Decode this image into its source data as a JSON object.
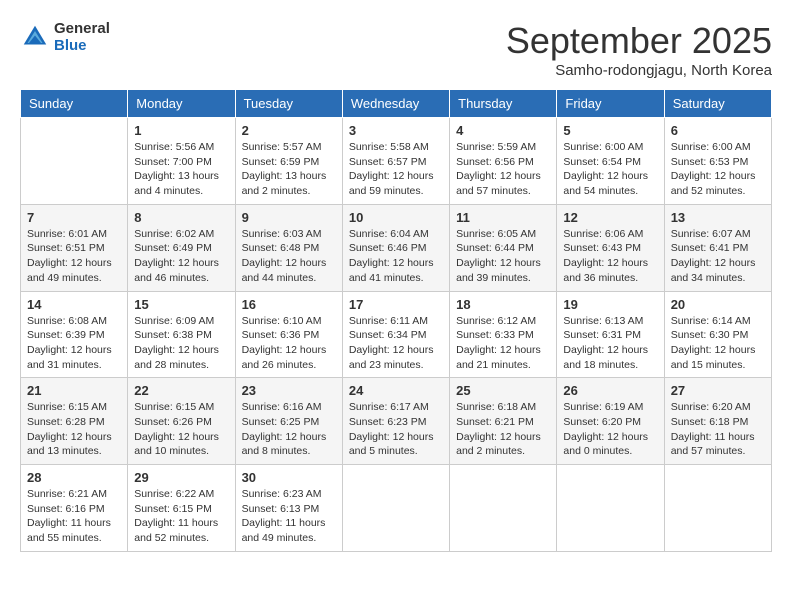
{
  "header": {
    "logo_general": "General",
    "logo_blue": "Blue",
    "month": "September 2025",
    "location": "Samho-rodongjagu, North Korea"
  },
  "days_of_week": [
    "Sunday",
    "Monday",
    "Tuesday",
    "Wednesday",
    "Thursday",
    "Friday",
    "Saturday"
  ],
  "weeks": [
    [
      {
        "day": "",
        "info": ""
      },
      {
        "day": "1",
        "info": "Sunrise: 5:56 AM\nSunset: 7:00 PM\nDaylight: 13 hours\nand 4 minutes."
      },
      {
        "day": "2",
        "info": "Sunrise: 5:57 AM\nSunset: 6:59 PM\nDaylight: 13 hours\nand 2 minutes."
      },
      {
        "day": "3",
        "info": "Sunrise: 5:58 AM\nSunset: 6:57 PM\nDaylight: 12 hours\nand 59 minutes."
      },
      {
        "day": "4",
        "info": "Sunrise: 5:59 AM\nSunset: 6:56 PM\nDaylight: 12 hours\nand 57 minutes."
      },
      {
        "day": "5",
        "info": "Sunrise: 6:00 AM\nSunset: 6:54 PM\nDaylight: 12 hours\nand 54 minutes."
      },
      {
        "day": "6",
        "info": "Sunrise: 6:00 AM\nSunset: 6:53 PM\nDaylight: 12 hours\nand 52 minutes."
      }
    ],
    [
      {
        "day": "7",
        "info": "Sunrise: 6:01 AM\nSunset: 6:51 PM\nDaylight: 12 hours\nand 49 minutes."
      },
      {
        "day": "8",
        "info": "Sunrise: 6:02 AM\nSunset: 6:49 PM\nDaylight: 12 hours\nand 46 minutes."
      },
      {
        "day": "9",
        "info": "Sunrise: 6:03 AM\nSunset: 6:48 PM\nDaylight: 12 hours\nand 44 minutes."
      },
      {
        "day": "10",
        "info": "Sunrise: 6:04 AM\nSunset: 6:46 PM\nDaylight: 12 hours\nand 41 minutes."
      },
      {
        "day": "11",
        "info": "Sunrise: 6:05 AM\nSunset: 6:44 PM\nDaylight: 12 hours\nand 39 minutes."
      },
      {
        "day": "12",
        "info": "Sunrise: 6:06 AM\nSunset: 6:43 PM\nDaylight: 12 hours\nand 36 minutes."
      },
      {
        "day": "13",
        "info": "Sunrise: 6:07 AM\nSunset: 6:41 PM\nDaylight: 12 hours\nand 34 minutes."
      }
    ],
    [
      {
        "day": "14",
        "info": "Sunrise: 6:08 AM\nSunset: 6:39 PM\nDaylight: 12 hours\nand 31 minutes."
      },
      {
        "day": "15",
        "info": "Sunrise: 6:09 AM\nSunset: 6:38 PM\nDaylight: 12 hours\nand 28 minutes."
      },
      {
        "day": "16",
        "info": "Sunrise: 6:10 AM\nSunset: 6:36 PM\nDaylight: 12 hours\nand 26 minutes."
      },
      {
        "day": "17",
        "info": "Sunrise: 6:11 AM\nSunset: 6:34 PM\nDaylight: 12 hours\nand 23 minutes."
      },
      {
        "day": "18",
        "info": "Sunrise: 6:12 AM\nSunset: 6:33 PM\nDaylight: 12 hours\nand 21 minutes."
      },
      {
        "day": "19",
        "info": "Sunrise: 6:13 AM\nSunset: 6:31 PM\nDaylight: 12 hours\nand 18 minutes."
      },
      {
        "day": "20",
        "info": "Sunrise: 6:14 AM\nSunset: 6:30 PM\nDaylight: 12 hours\nand 15 minutes."
      }
    ],
    [
      {
        "day": "21",
        "info": "Sunrise: 6:15 AM\nSunset: 6:28 PM\nDaylight: 12 hours\nand 13 minutes."
      },
      {
        "day": "22",
        "info": "Sunrise: 6:15 AM\nSunset: 6:26 PM\nDaylight: 12 hours\nand 10 minutes."
      },
      {
        "day": "23",
        "info": "Sunrise: 6:16 AM\nSunset: 6:25 PM\nDaylight: 12 hours\nand 8 minutes."
      },
      {
        "day": "24",
        "info": "Sunrise: 6:17 AM\nSunset: 6:23 PM\nDaylight: 12 hours\nand 5 minutes."
      },
      {
        "day": "25",
        "info": "Sunrise: 6:18 AM\nSunset: 6:21 PM\nDaylight: 12 hours\nand 2 minutes."
      },
      {
        "day": "26",
        "info": "Sunrise: 6:19 AM\nSunset: 6:20 PM\nDaylight: 12 hours\nand 0 minutes."
      },
      {
        "day": "27",
        "info": "Sunrise: 6:20 AM\nSunset: 6:18 PM\nDaylight: 11 hours\nand 57 minutes."
      }
    ],
    [
      {
        "day": "28",
        "info": "Sunrise: 6:21 AM\nSunset: 6:16 PM\nDaylight: 11 hours\nand 55 minutes."
      },
      {
        "day": "29",
        "info": "Sunrise: 6:22 AM\nSunset: 6:15 PM\nDaylight: 11 hours\nand 52 minutes."
      },
      {
        "day": "30",
        "info": "Sunrise: 6:23 AM\nSunset: 6:13 PM\nDaylight: 11 hours\nand 49 minutes."
      },
      {
        "day": "",
        "info": ""
      },
      {
        "day": "",
        "info": ""
      },
      {
        "day": "",
        "info": ""
      },
      {
        "day": "",
        "info": ""
      }
    ]
  ]
}
